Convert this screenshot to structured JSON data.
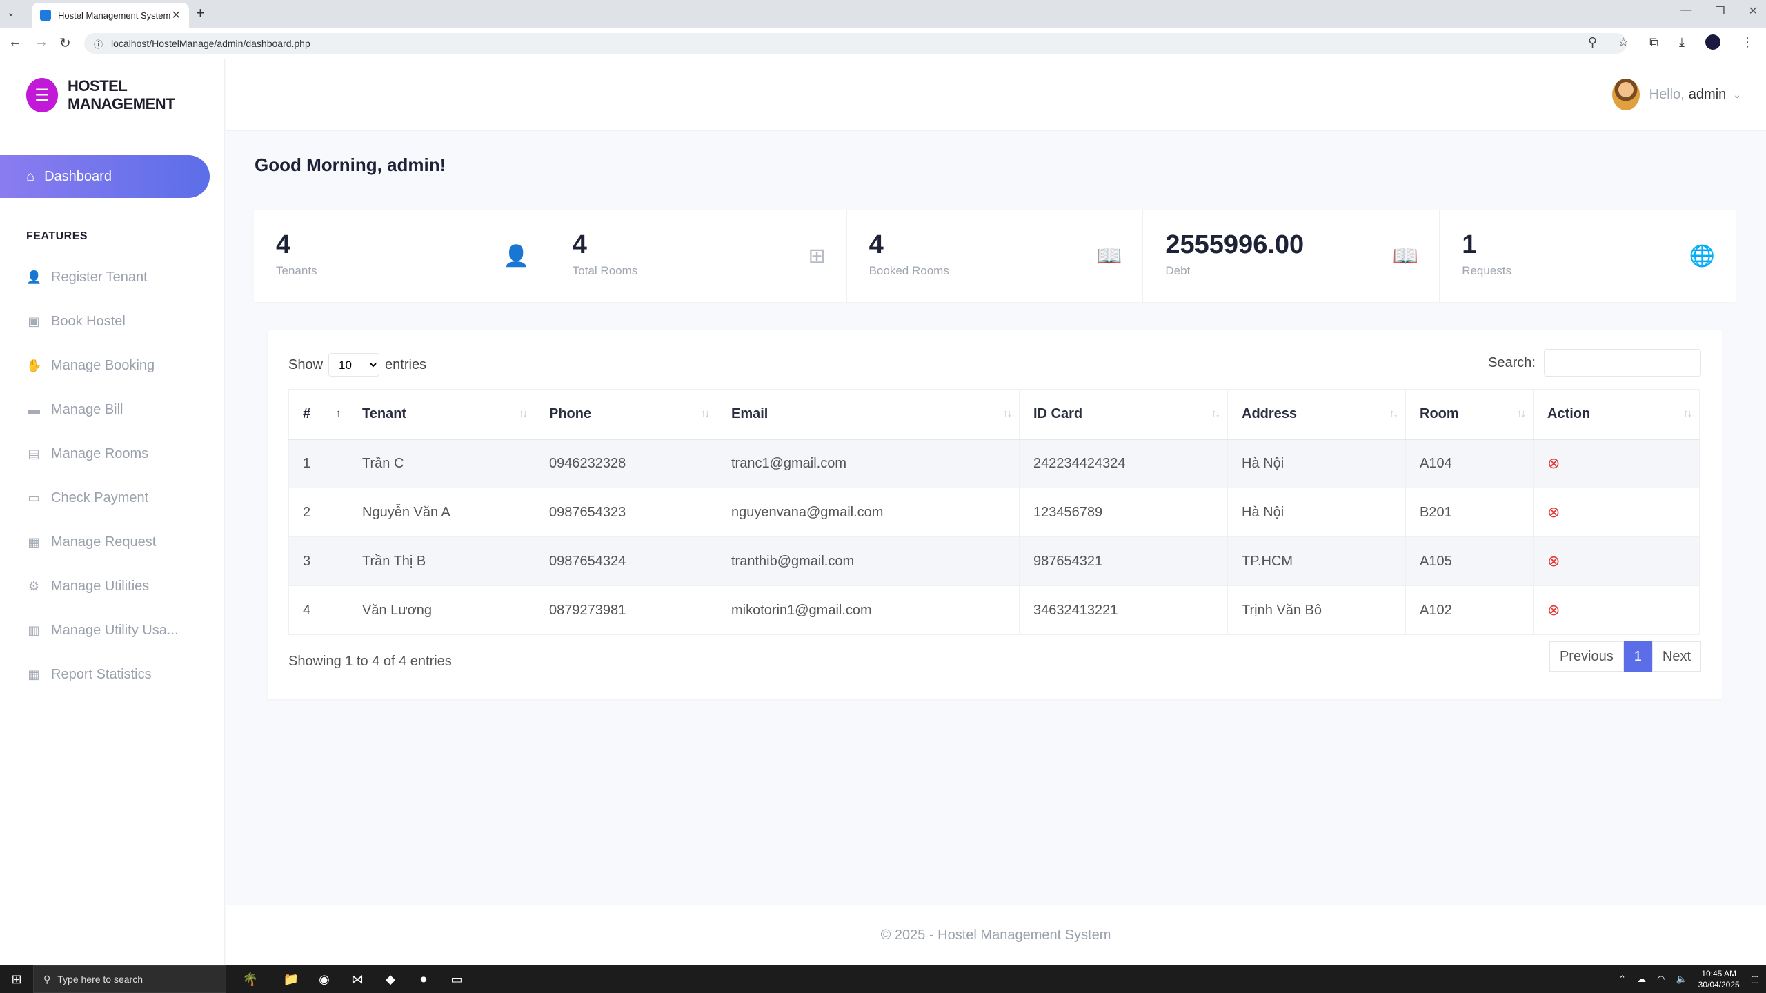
{
  "browser": {
    "tab_title": "Hostel Management System",
    "url": "localhost/HostelManage/admin/dashboard.php"
  },
  "sidebar": {
    "brand": "HOSTEL MANAGEMENT",
    "active": {
      "label": "Dashboard",
      "icon": "home-icon"
    },
    "section_title": "FEATURES",
    "items": [
      {
        "label": "Register Tenant",
        "icon": "user-plus-icon"
      },
      {
        "label": "Book Hostel",
        "icon": "bookmark-icon"
      },
      {
        "label": "Manage Booking",
        "icon": "handshake-icon"
      },
      {
        "label": "Manage Bill",
        "icon": "folder-icon"
      },
      {
        "label": "Manage Rooms",
        "icon": "bed-icon"
      },
      {
        "label": "Check Payment",
        "icon": "credit-card-icon"
      },
      {
        "label": "Manage Request",
        "icon": "inbox-icon"
      },
      {
        "label": "Manage Utilities",
        "icon": "gears-icon"
      },
      {
        "label": "Manage Utility Usa...",
        "icon": "clipboard-icon"
      },
      {
        "label": "Report Statistics",
        "icon": "calculator-icon"
      }
    ]
  },
  "header": {
    "hello": "Hello,",
    "username": "admin"
  },
  "greeting": "Good Morning, admin!",
  "stats": [
    {
      "value": "4",
      "label": "Tenants",
      "icon": "user-plus-icon"
    },
    {
      "value": "4",
      "label": "Total Rooms",
      "icon": "grid-icon"
    },
    {
      "value": "4",
      "label": "Booked Rooms",
      "icon": "book-icon"
    },
    {
      "value": "2555996.00",
      "label": "Debt",
      "icon": "book-icon"
    },
    {
      "value": "1",
      "label": "Requests",
      "icon": "globe-icon"
    }
  ],
  "table": {
    "show_label": "Show",
    "entries_label": "entries",
    "page_size": "10",
    "search_label": "Search:",
    "columns": [
      "#",
      "Tenant",
      "Phone",
      "Email",
      "ID Card",
      "Address",
      "Room",
      "Action"
    ],
    "rows": [
      [
        "1",
        "Trần C",
        "0946232328",
        "tranc1@gmail.com",
        "242234424324",
        "Hà Nội",
        "A104"
      ],
      [
        "2",
        "Nguyễn Văn A",
        "0987654323",
        "nguyenvana@gmail.com",
        "123456789",
        "Hà Nội",
        "B201"
      ],
      [
        "3",
        "Trần Thị B",
        "0987654324",
        "tranthib@gmail.com",
        "987654321",
        "TP.HCM",
        "A105"
      ],
      [
        "4",
        "Văn Lương",
        "0879273981",
        "mikotorin1@gmail.com",
        "34632413221",
        "Trịnh Văn Bô",
        "A102"
      ]
    ],
    "info": "Showing 1 to 4 of 4 entries",
    "pager": {
      "previous": "Previous",
      "current": "1",
      "next": "Next"
    }
  },
  "footer": "© 2025 - Hostel Management System",
  "taskbar": {
    "search_placeholder": "Type here to search",
    "time": "10:45 AM",
    "date": "30/04/2025"
  }
}
